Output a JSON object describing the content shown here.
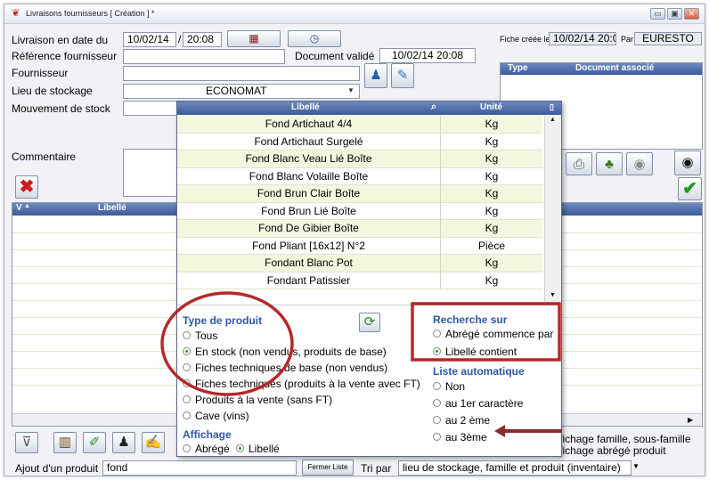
{
  "window": {
    "title": "Livraisons fournisseurs  [ Création ] *",
    "min_glyph": "▭",
    "max_glyph": "▣",
    "close_glyph": "✕"
  },
  "form": {
    "date_label": "Livraison en date du",
    "date_value": "10/02/14",
    "date_sep": "/",
    "time_value": "20:08",
    "ref_label": "Référence fournisseur",
    "ref_value": "",
    "supplier_label": "Fournisseur",
    "supplier_value": "",
    "storage_label": "Lieu de stockage",
    "storage_value": "ECONOMAT",
    "movement_label": "Mouvement de stock",
    "comment_label": "Commentaire",
    "doc_validated_label": "Document validé",
    "doc_validated_value": "10/02/14 20:08",
    "created_label": "Fiche créée le",
    "created_value": "10/02/14 20:08",
    "by_label": "Par",
    "by_value": "EURESTO"
  },
  "docs_table": {
    "col_type": "Type",
    "col_doc": "Document associé"
  },
  "main_grid": {
    "col_v": "V",
    "col_lib": "Libellé",
    "sort_glyph": "▲"
  },
  "dropdown": {
    "col_libelle": "Libellé",
    "col_unite": "Unité",
    "search_glyph": "⌕",
    "rows": [
      {
        "libelle": "Fond Artichaut 4/4",
        "unite": "Kg"
      },
      {
        "libelle": "Fond Artichaut Surgelé",
        "unite": "Kg"
      },
      {
        "libelle": "Fond Blanc Veau Lié Boîte",
        "unite": "Kg"
      },
      {
        "libelle": "Fond Blanc Volaille Boîte",
        "unite": "Kg"
      },
      {
        "libelle": "Fond Brun Clair Boîte",
        "unite": "Kg"
      },
      {
        "libelle": "Fond Brun Lié Boîte",
        "unite": "Kg"
      },
      {
        "libelle": "Fond De Gibier Boîte",
        "unite": "Kg"
      },
      {
        "libelle": "Fond Pliant [16x12] N°2",
        "unite": "Pièce"
      },
      {
        "libelle": "Fondant Blanc Pot",
        "unite": "Kg"
      },
      {
        "libelle": "Fondant Patissier",
        "unite": "Kg"
      }
    ],
    "type_title": "Type de produit",
    "type_options": [
      "Tous",
      "En stock (non vendus, produits de base)",
      "Fiches techniques de base (non vendus)",
      "Fiches techniques (produits à la vente avec FT)",
      "Produits à la vente (sans FT)",
      "Cave (vins)"
    ],
    "type_selected": 1,
    "affichage_title": "Affichage",
    "affichage_abrege": "Abrégé",
    "affichage_libelle": "Libellé",
    "affichage_selected": "Libellé",
    "recherche_title": "Recherche sur",
    "recherche_options": [
      "Abrégé commence par",
      "Libellé contient"
    ],
    "recherche_selected": 1,
    "liste_title": "Liste automatique",
    "liste_options": [
      "Non",
      "au 1er caractère",
      "au 2 ème",
      "au 3ème"
    ]
  },
  "bottom": {
    "right_text_1": "ffichage famille, sous-famille",
    "right_text_2": "ffichage abrégé produit",
    "add_label": "Ajout d'un produit",
    "add_value": "fond",
    "close_list_label": "Fermer Liste",
    "sort_label": "Tri par",
    "sort_value": "lieu de stockage, famille et produit (inventaire)"
  },
  "colors": {
    "annotation_red": "#b5282a",
    "annotation_arrow": "#8b2b2b",
    "list_header": "#4a67a6",
    "row_alt": "#f2f7de",
    "section_blue": "#2f57a8"
  }
}
